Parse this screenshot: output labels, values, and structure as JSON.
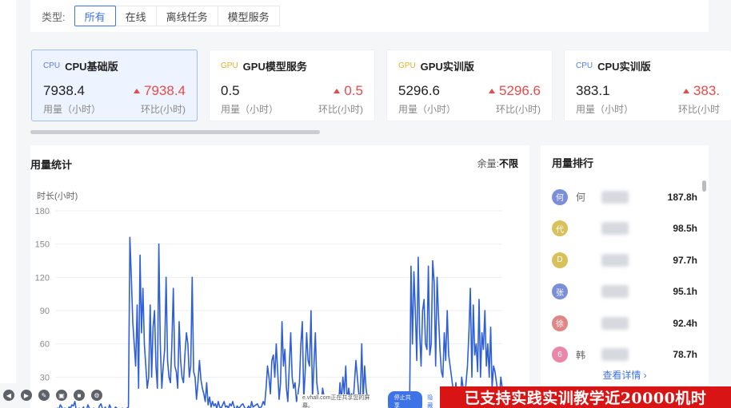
{
  "filter": {
    "label": "类型:",
    "tabs": [
      "所有",
      "在线",
      "离线任务",
      "模型服务"
    ],
    "active_index": 0
  },
  "cards": [
    {
      "tag": "CPU",
      "title": "CPU基础版",
      "value": "7938.4",
      "trend": "7938.4",
      "value_label": "用量（小时）",
      "trend_label": "环比(小时)"
    },
    {
      "tag": "GPU",
      "title": "GPU模型服务",
      "value": "0.5",
      "trend": "0.5",
      "value_label": "用量（小时）",
      "trend_label": "环比(小时)"
    },
    {
      "tag": "GPU",
      "title": "GPU实训版",
      "value": "5296.6",
      "trend": "5296.6",
      "value_label": "用量（小时）",
      "trend_label": "环比(小时)"
    },
    {
      "tag": "CPU",
      "title": "CPU实训版",
      "value": "383.1",
      "trend": "383.",
      "value_label": "用量（小时）",
      "trend_label": "环比(小时"
    }
  ],
  "usage": {
    "title": "用量统计",
    "remain_label": "余量:",
    "remain_value": "不限"
  },
  "chart_data": {
    "type": "line",
    "ylabel": "时长(小时)",
    "ylim": [
      0,
      180
    ],
    "yticks": [
      180,
      150,
      120,
      90,
      60,
      30
    ],
    "color": "#2f5fd6",
    "values": [
      0,
      2,
      1,
      5,
      3,
      0,
      2,
      1,
      0,
      3,
      2,
      5,
      4,
      8,
      0,
      0,
      2,
      0,
      1,
      3,
      0,
      0,
      5,
      2,
      0,
      0,
      2,
      1,
      0,
      0,
      4,
      6,
      2,
      0,
      3,
      0,
      0,
      5,
      2,
      0,
      0,
      3,
      2,
      0,
      0,
      1,
      2,
      0,
      0,
      2,
      3,
      156,
      120,
      80,
      60,
      40,
      95,
      20,
      140,
      70,
      110,
      60,
      40,
      20,
      30,
      95,
      30,
      75,
      90,
      40,
      20,
      150,
      60,
      20,
      40,
      55,
      120,
      45,
      30,
      25,
      60,
      110,
      40,
      35,
      20,
      80,
      45,
      30,
      25,
      50,
      70,
      60,
      30,
      40,
      120,
      35,
      30,
      10,
      25,
      45,
      28,
      20,
      15,
      8,
      25,
      5,
      12,
      3,
      8,
      4,
      6,
      2,
      8,
      3,
      2,
      5,
      8,
      3,
      4,
      2,
      6,
      4,
      8,
      3,
      0,
      4,
      2,
      3,
      5,
      6,
      3,
      1,
      2,
      4,
      0,
      8,
      3,
      4,
      5,
      6,
      3,
      2,
      4,
      8,
      5,
      20,
      40,
      30,
      15,
      45,
      50,
      30,
      60,
      35,
      10,
      25,
      80,
      40,
      55,
      20,
      8,
      40,
      70,
      30,
      20,
      25,
      8,
      15,
      25,
      60,
      80,
      10,
      35,
      70,
      45,
      40,
      90,
      10,
      40,
      70,
      25,
      15,
      10,
      5,
      20,
      12,
      5,
      2,
      0,
      3,
      1,
      2,
      5,
      2,
      0,
      4,
      25,
      8,
      30,
      15,
      40,
      8,
      20,
      10,
      15,
      6,
      25,
      45,
      30,
      15,
      12,
      60,
      10,
      40,
      20,
      10,
      8,
      5,
      0,
      3,
      2,
      1,
      4,
      2,
      3,
      0,
      2,
      1,
      3,
      0,
      2,
      1,
      0,
      2,
      0,
      1,
      3,
      0,
      2,
      0,
      1,
      0,
      0,
      2,
      1,
      130,
      60,
      125,
      90,
      45,
      138,
      70,
      40,
      90,
      100,
      60,
      55,
      130,
      50,
      60,
      135,
      115,
      40,
      120,
      85,
      55,
      35,
      30,
      70,
      45,
      90,
      50,
      40,
      30,
      20,
      10,
      25,
      10,
      15,
      8,
      30,
      20,
      10,
      25,
      40,
      70,
      110,
      30,
      95,
      50,
      60,
      35,
      100,
      30,
      70,
      55,
      90,
      40,
      60,
      30,
      75,
      20,
      40,
      35,
      25,
      15,
      10,
      30,
      20
    ]
  },
  "ranking": {
    "title": "用量排行",
    "items": [
      {
        "avatar": "何",
        "name": "何",
        "color": "#7b8fd8",
        "value": "187.8h"
      },
      {
        "avatar": "代",
        "name": "",
        "color": "#d8c05a",
        "value": "98.5h"
      },
      {
        "avatar": "D",
        "name": "",
        "color": "#d8c05a",
        "value": "97.7h"
      },
      {
        "avatar": "张",
        "name": "",
        "color": "#7b8fd8",
        "value": "95.1h"
      },
      {
        "avatar": "徐",
        "name": "",
        "color": "#e08686",
        "value": "92.4h"
      },
      {
        "avatar": "6",
        "name": "韩",
        "color": "#e887a8",
        "value": "78.7h"
      }
    ],
    "more_label": "查看详情 ›"
  },
  "share": {
    "text": "e.vhall.com正在共享您的屏幕。",
    "stop_label": "停止共享",
    "hide_label": "隐藏"
  },
  "banner": "已支持实践实训教学近20000机时"
}
